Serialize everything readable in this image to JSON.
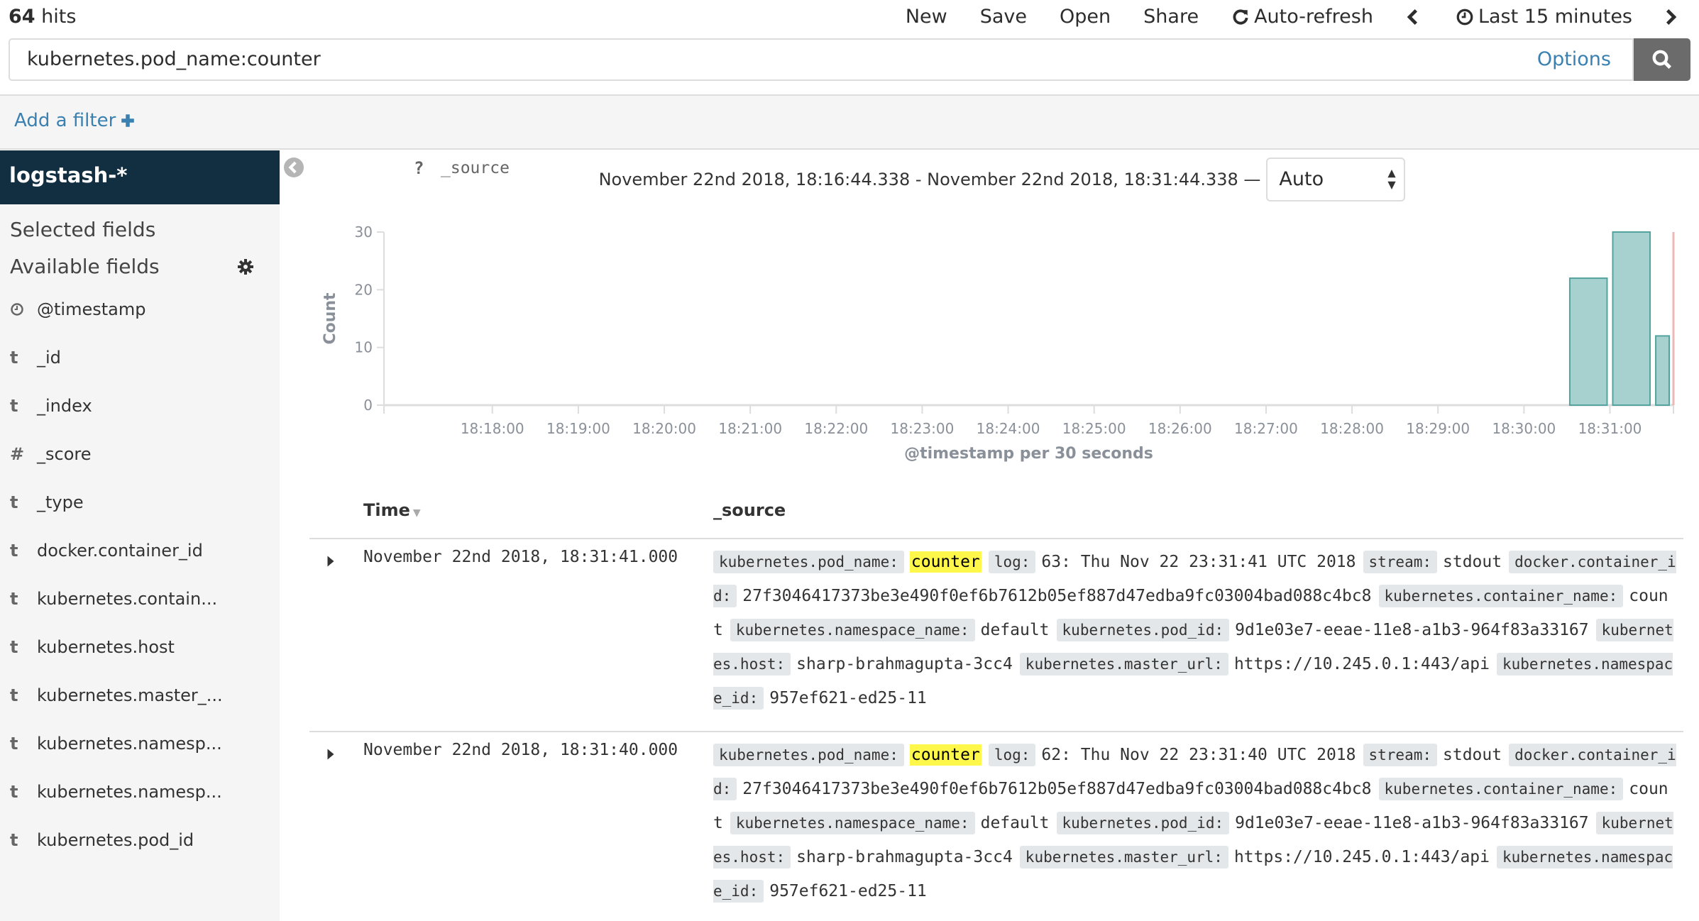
{
  "header": {
    "hits_count": "64",
    "hits_label": " hits",
    "menu": [
      {
        "label": "New",
        "icon": ""
      },
      {
        "label": "Save",
        "icon": ""
      },
      {
        "label": "Open",
        "icon": ""
      },
      {
        "label": "Share",
        "icon": ""
      },
      {
        "label": "Auto-refresh",
        "icon": "refresh-icon"
      },
      {
        "label": "",
        "icon": "chevron-left-icon"
      },
      {
        "label": "Last 15 minutes",
        "icon": "clock-icon"
      },
      {
        "label": "",
        "icon": "chevron-right-icon"
      }
    ]
  },
  "query": {
    "value": "kubernetes.pod_name:counter",
    "options_label": "Options",
    "search_icon": "search-icon"
  },
  "filter": {
    "add_label": "Add a filter"
  },
  "sidebar": {
    "index_pattern": "logstash-*",
    "selected_title": "Selected fields",
    "selected_fields": [
      {
        "type": "?",
        "name": "_source"
      }
    ],
    "available_title": "Available fields",
    "available_fields": [
      {
        "type": "clock",
        "name": "@timestamp"
      },
      {
        "type": "t",
        "name": "_id"
      },
      {
        "type": "t",
        "name": "_index"
      },
      {
        "type": "#",
        "name": "_score"
      },
      {
        "type": "t",
        "name": "_type"
      },
      {
        "type": "t",
        "name": "docker.container_id"
      },
      {
        "type": "t",
        "name": "kubernetes.contain..."
      },
      {
        "type": "t",
        "name": "kubernetes.host"
      },
      {
        "type": "t",
        "name": "kubernetes.master_..."
      },
      {
        "type": "t",
        "name": "kubernetes.namesp..."
      },
      {
        "type": "t",
        "name": "kubernetes.namesp..."
      },
      {
        "type": "t",
        "name": "kubernetes.pod_id"
      }
    ]
  },
  "range": {
    "text": "November 22nd 2018, 18:16:44.338 - November 22nd 2018, 18:31:44.338 —",
    "interval": "Auto"
  },
  "chart_data": {
    "type": "bar",
    "title": "",
    "xlabel": "@timestamp per 30 seconds",
    "ylabel": "Count",
    "ylim": [
      0,
      30
    ],
    "yticks": [
      0,
      10,
      20,
      30
    ],
    "x_range": [
      "18:16:44.338",
      "18:31:44.338"
    ],
    "xticks": [
      "18:18:00",
      "18:19:00",
      "18:20:00",
      "18:21:00",
      "18:22:00",
      "18:23:00",
      "18:24:00",
      "18:25:00",
      "18:26:00",
      "18:27:00",
      "18:28:00",
      "18:29:00",
      "18:30:00",
      "18:31:00"
    ],
    "categories": [
      "18:30:30",
      "18:31:00",
      "18:31:30"
    ],
    "values": [
      22,
      30,
      12
    ],
    "bar_color": "#a6d1ce",
    "bar_stroke": "#54a39e",
    "now_marker": "18:31:44.338",
    "now_marker_color": "#e7a6a6",
    "grid": false,
    "legend": "none"
  },
  "table": {
    "col_time": "Time",
    "col_source": "_source",
    "rows": [
      {
        "time": "November 22nd 2018, 18:31:41.000",
        "fields": [
          {
            "k": "kubernetes.pod_name:",
            "v": "counter",
            "hl": true
          },
          {
            "k": "log:",
            "v": "63: Thu Nov 22 23:31:41 UTC 2018"
          },
          {
            "k": "stream:",
            "v": "stdout"
          },
          {
            "k": "docker.container_id:",
            "v": "27f3046417373be3e490f0ef6b7612b05ef887d47edba9fc03004bad088c4bc8"
          },
          {
            "k": "kubernetes.container_name:",
            "v": "count"
          },
          {
            "k": "kubernetes.namespace_name:",
            "v": "default"
          },
          {
            "k": "kubernetes.pod_id:",
            "v": "9d1e03e7-eeae-11e8-a1b3-964f83a33167"
          },
          {
            "k": "kubernetes.host:",
            "v": "sharp-brahmagupta-3cc4"
          },
          {
            "k": "kubernetes.master_url:",
            "v": "https://10.245.0.1:443/api"
          },
          {
            "k": "kubernetes.namespace_id:",
            "v": "957ef621-ed25-11"
          }
        ]
      },
      {
        "time": "November 22nd 2018, 18:31:40.000",
        "fields": [
          {
            "k": "kubernetes.pod_name:",
            "v": "counter",
            "hl": true
          },
          {
            "k": "log:",
            "v": "62: Thu Nov 22 23:31:40 UTC 2018"
          },
          {
            "k": "stream:",
            "v": "stdout"
          },
          {
            "k": "docker.container_id:",
            "v": "27f3046417373be3e490f0ef6b7612b05ef887d47edba9fc03004bad088c4bc8"
          },
          {
            "k": "kubernetes.container_name:",
            "v": "count"
          },
          {
            "k": "kubernetes.namespace_name:",
            "v": "default"
          },
          {
            "k": "kubernetes.pod_id:",
            "v": "9d1e03e7-eeae-11e8-a1b3-964f83a33167"
          },
          {
            "k": "kubernetes.host:",
            "v": "sharp-brahmagupta-3cc4"
          },
          {
            "k": "kubernetes.master_url:",
            "v": "https://10.245.0.1:443/api"
          },
          {
            "k": "kubernetes.namespace_id:",
            "v": "957ef621-ed25-11"
          }
        ]
      }
    ]
  }
}
